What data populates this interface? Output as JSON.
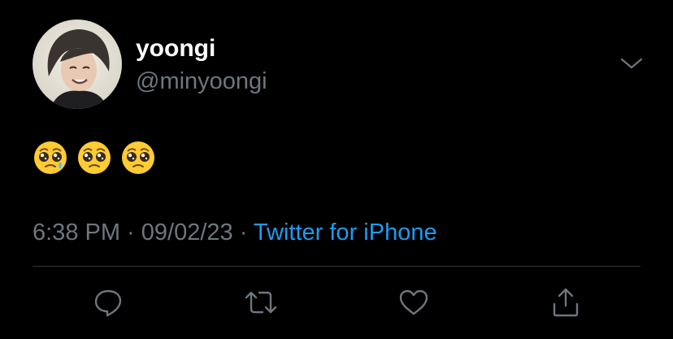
{
  "tweet": {
    "author": {
      "display_name": "yoongi",
      "handle": "@minyoongi",
      "avatar_icon": "profile-photo"
    },
    "text_emojis": [
      "pleading-face",
      "pleading-face",
      "pleading-face"
    ],
    "meta": {
      "time": "6:38 PM",
      "separator": " · ",
      "date": "09/02/23",
      "source": "Twitter for iPhone"
    },
    "actions": [
      {
        "icon": "reply-icon"
      },
      {
        "icon": "retweet-icon"
      },
      {
        "icon": "like-icon"
      },
      {
        "icon": "share-icon"
      }
    ]
  },
  "colors": {
    "background": "#000000",
    "primary_text": "#ffffff",
    "secondary_text": "#6e767d",
    "link": "#1d9bf0",
    "divider": "#2f3336"
  }
}
